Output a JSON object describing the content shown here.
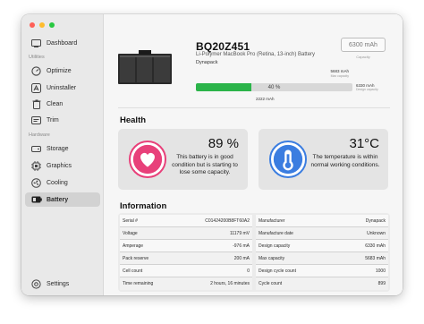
{
  "sidebar": {
    "top_item": {
      "label": "Dashboard",
      "icon": "dashboard-icon"
    },
    "sections": [
      {
        "label": "Utilities",
        "items": [
          {
            "label": "Optimize",
            "icon": "speedometer-icon"
          },
          {
            "label": "Uninstaller",
            "icon": "app-store-icon"
          },
          {
            "label": "Clean",
            "icon": "trash-icon"
          },
          {
            "label": "Trim",
            "icon": "scissors-icon"
          }
        ]
      },
      {
        "label": "Hardware",
        "items": [
          {
            "label": "Storage",
            "icon": "disk-icon"
          },
          {
            "label": "Graphics",
            "icon": "gpu-icon"
          },
          {
            "label": "Cooling",
            "icon": "fan-icon"
          },
          {
            "label": "Battery",
            "icon": "battery-icon"
          }
        ]
      }
    ],
    "bottom_item": {
      "label": "Settings",
      "icon": "gear-icon"
    },
    "active": "Battery"
  },
  "battery": {
    "model": "BQ20Z451",
    "description": "Li-Polymer MacBook Pro (Retina, 13-inch) Battery",
    "manufacturer": "Dynapack",
    "capacity_box": "6300 mAh",
    "capacity_box_label": "Capacity",
    "max_capacity": "5683 mAh",
    "max_capacity_label": "Max capacity",
    "design_capacity": "6330 mAh",
    "design_capacity_label": "Design capacity",
    "current_capacity": "2222 mAh",
    "charge_percent_label": "40 %",
    "charge_fraction": 0.4,
    "charge_fill_fraction": 0.355,
    "max_fill_fraction": 0.898
  },
  "health": {
    "title": "Health",
    "battery_health": {
      "value": "89 %",
      "text": "This battery is in good condition but is starting to lose some capacity.",
      "icon": "heart-icon"
    },
    "temperature": {
      "value": "31°C",
      "text": "The temperature is within normal working conditions.",
      "icon": "thermometer-icon"
    }
  },
  "information": {
    "title": "Information",
    "left": [
      {
        "key": "Serial #",
        "value": "C01424200B8FT60A2"
      },
      {
        "key": "Voltage",
        "value": "11179 mV"
      },
      {
        "key": "Amperage",
        "value": "-976 mA"
      },
      {
        "key": "Pack reserve",
        "value": "200 mA"
      },
      {
        "key": "Cell count",
        "value": "0"
      },
      {
        "key": "Time remaining",
        "value": "2 hours, 16 minutes"
      }
    ],
    "right": [
      {
        "key": "Manufacturer",
        "value": "Dynapack"
      },
      {
        "key": "Manufacture date",
        "value": "Unknown"
      },
      {
        "key": "Design capacity",
        "value": "6330 mAh"
      },
      {
        "key": "Max capacity",
        "value": "5683 mAh"
      },
      {
        "key": "Design cycle count",
        "value": "1000"
      },
      {
        "key": "Cycle count",
        "value": "899"
      }
    ]
  },
  "colors": {
    "charge_fill": "#2bb44a",
    "health_icon": "#e8407a",
    "temperature_icon": "#3b7de0"
  }
}
